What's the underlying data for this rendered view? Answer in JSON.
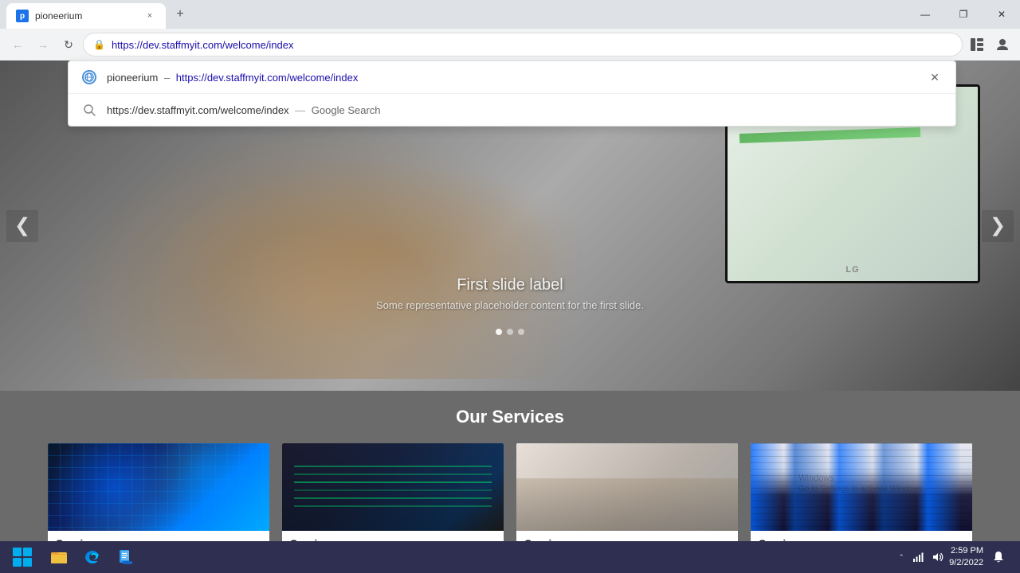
{
  "browser": {
    "tab": {
      "title": "pioneerium",
      "favicon_label": "p",
      "close_label": "×"
    },
    "new_tab_label": "+",
    "window_controls": {
      "minimize": "—",
      "maximize": "❐",
      "close": "✕"
    },
    "nav": {
      "back_label": "←",
      "forward_label": "→",
      "refresh_label": "↻"
    },
    "address_bar": {
      "url": "https://dev.staffmyit.com/welcome/index",
      "lock_icon": "🔒"
    },
    "sidebar_icon": "⊞",
    "profile_icon": "👤"
  },
  "autocomplete": {
    "items": [
      {
        "type": "site",
        "site_name": "pioneerium",
        "dash": "–",
        "url": "https://dev.staffmyit.com/welcome/index",
        "show_close": true
      },
      {
        "type": "search",
        "url_text": "https://dev.staffmyit.com/welcome/index",
        "separator": "—",
        "label": "Google Search"
      }
    ]
  },
  "hero": {
    "slide_label": "First slide label",
    "slide_desc": "Some representative placeholder content for the first slide.",
    "prev_label": "❮",
    "next_label": "❯",
    "indicators": [
      {
        "active": true
      },
      {
        "active": false
      },
      {
        "active": false
      }
    ],
    "monitor_brand": "LG"
  },
  "services": {
    "title": "Our Services",
    "cards": [
      {
        "label": "Service",
        "img_class": "service-img-1"
      },
      {
        "label": "Service",
        "img_class": "service-img-2"
      },
      {
        "label": "Service",
        "img_class": "service-img-3"
      },
      {
        "label": "Service",
        "img_class": "service-img-4"
      }
    ]
  },
  "windows_watermark": {
    "line1": "Windows",
    "line2": "Go to Settings to activate Windows."
  },
  "taskbar": {
    "clock": {
      "time": "2:59 PM",
      "date": "9/2/2022"
    },
    "items": [
      {
        "name": "file-explorer",
        "label": ""
      },
      {
        "name": "edge",
        "label": ""
      },
      {
        "name": "files",
        "label": ""
      }
    ]
  }
}
